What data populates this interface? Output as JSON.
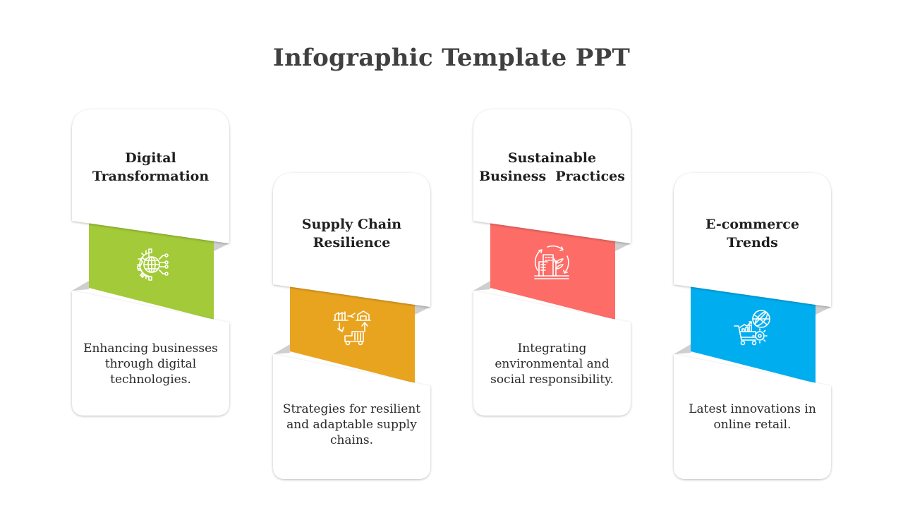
{
  "slide": {
    "title": "Infographic Template PPT"
  },
  "cards": [
    {
      "title_line1": "Digital",
      "title_line2": "Transformation",
      "description_lines": [
        "Enhancing businesses",
        "through digital",
        "technologies."
      ],
      "icon": "digital-globe-gear-icon",
      "color": "#A3CA38"
    },
    {
      "title_line1": "Supply Chain",
      "title_line2": "Resilience",
      "description_lines": [
        "Strategies for resilient",
        "and adaptable supply",
        "chains."
      ],
      "icon": "supply-chain-cycle-icon",
      "color": "#E9A41F"
    },
    {
      "title_line1": "Sustainable",
      "title_line2": "Business  Practices",
      "description_lines": [
        "Integrating",
        "environmental and",
        "social responsibility."
      ],
      "icon": "sustainable-building-icon",
      "color": "#FD6C67"
    },
    {
      "title_line1": "E-commerce",
      "title_line2": "Trends",
      "description_lines": [
        "Latest innovations in",
        "online retail."
      ],
      "icon": "ecommerce-cart-globe-icon",
      "color": "#00AEEF"
    }
  ]
}
